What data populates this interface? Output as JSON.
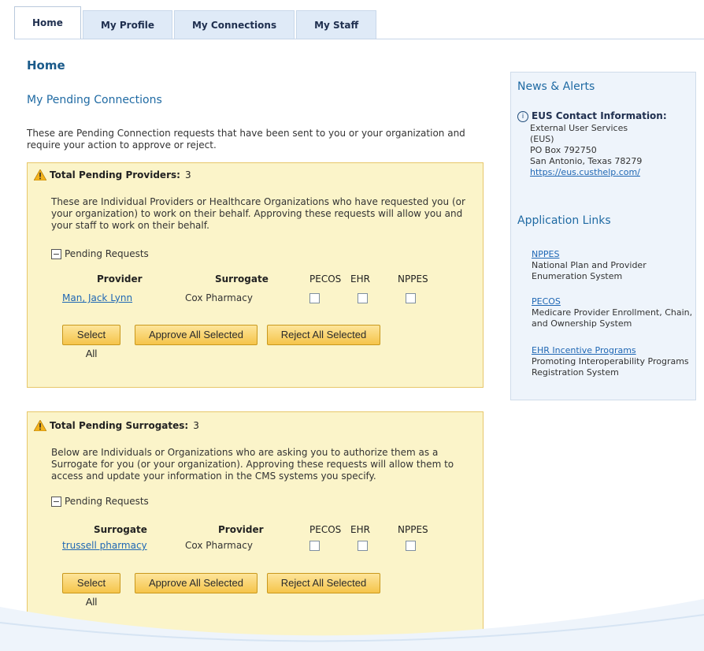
{
  "tabs": [
    {
      "label": "Home",
      "active": true
    },
    {
      "label": "My Profile"
    },
    {
      "label": "My Connections"
    },
    {
      "label": "My Staff"
    }
  ],
  "page_title": "Home",
  "section_title": "My Pending Connections",
  "intro": "These are Pending Connection requests that have been sent to you or your organization and require your action to approve or reject.",
  "providers_panel": {
    "heading": "Total Pending Providers:",
    "count": "3",
    "description": "These are Individual Providers or Healthcare Organizations who have requested you (or your organization) to work on their behalf. Approving these requests will allow you and your staff to work on their behalf.",
    "toggle_label": "Pending Requests",
    "columns": [
      "Provider",
      "Surrogate",
      "PECOS",
      "EHR",
      "NPPES"
    ],
    "rows": [
      {
        "name": "Man, Jack Lynn",
        "other": "Cox Pharmacy"
      }
    ],
    "buttons": {
      "select_all": "Select All",
      "approve": "Approve All Selected",
      "reject": "Reject All Selected"
    }
  },
  "surrogates_panel": {
    "heading": "Total Pending Surrogates:",
    "count": "3",
    "description": "Below are Individuals or Organizations who are asking you to authorize them as a Surrogate for you (or your organization). Approving these requests will allow them to access and update your information in the CMS systems you specify.",
    "toggle_label": "Pending Requests",
    "columns": [
      "Surrogate",
      "Provider",
      "PECOS",
      "EHR",
      "NPPES"
    ],
    "rows": [
      {
        "name": "trussell pharmacy",
        "other": "Cox Pharmacy"
      }
    ],
    "buttons": {
      "select_all": "Select All",
      "approve": "Approve All Selected",
      "reject": "Reject All Selected"
    }
  },
  "sidebar": {
    "news_title": "News & Alerts",
    "eus_title": "EUS Contact Information:",
    "eus_lines": [
      "External User Services",
      "(EUS)",
      "PO Box 792750",
      "San Antonio, Texas 78279"
    ],
    "eus_link": "https://eus.custhelp.com/",
    "app_links_title": "Application Links",
    "apps": [
      {
        "link": "NPPES",
        "desc": "National Plan and Provider Enumeration System"
      },
      {
        "link": "PECOS",
        "desc": "Medicare Provider Enrollment, Chain, and Ownership System"
      },
      {
        "link": "EHR Incentive Programs",
        "desc": "Promoting Interoperability Programs Registration System"
      }
    ]
  },
  "colors": {
    "panel_bg": "#fbf4c9",
    "panel_border": "#e7c76a",
    "link": "#1f67b4",
    "heading_blue": "#1f6aa3",
    "button": "#f5c44a"
  }
}
